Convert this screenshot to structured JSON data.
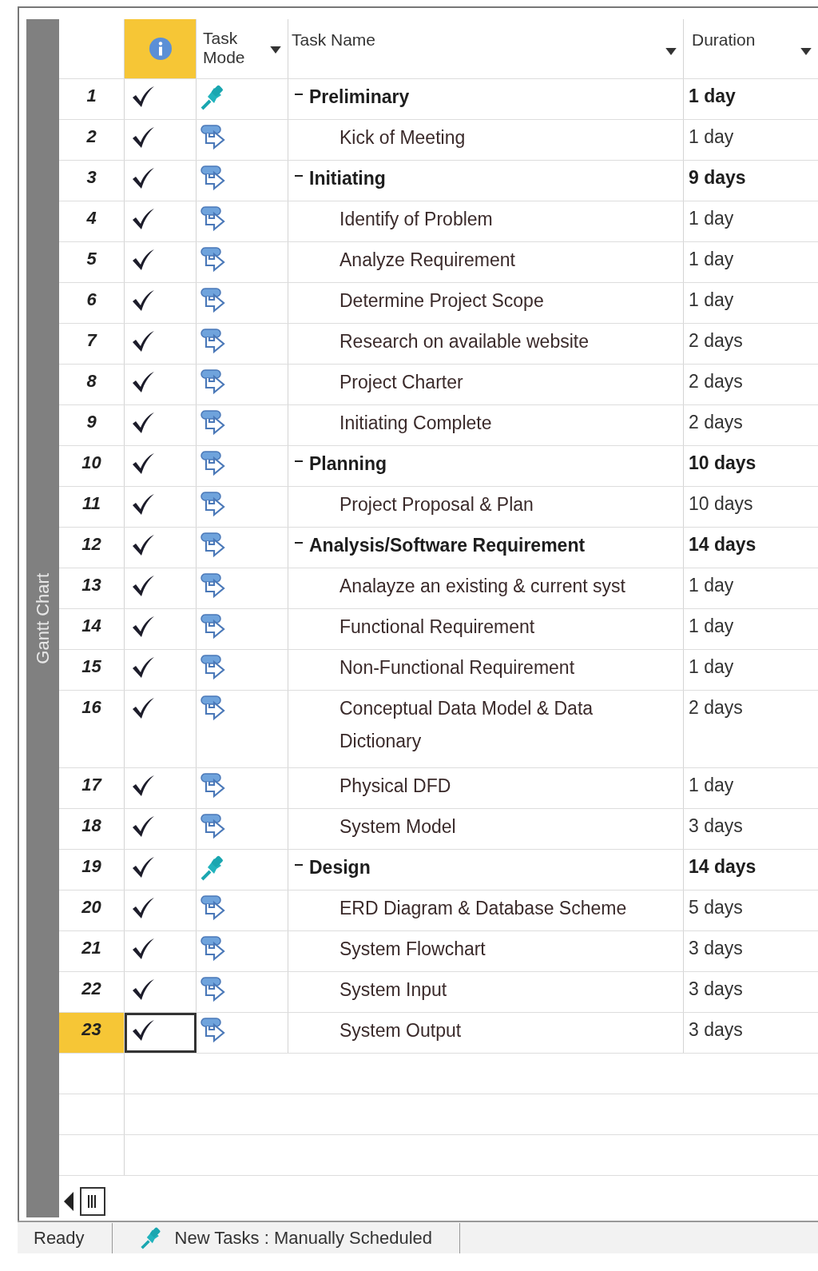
{
  "view_bar": {
    "label": "Gantt Chart"
  },
  "columns": [
    {
      "kind": "indicators"
    },
    {
      "kind": "mode",
      "label": "Task Mode"
    },
    {
      "kind": "name",
      "label": "Task Name"
    },
    {
      "kind": "duration",
      "label": "Duration"
    }
  ],
  "tasks": [
    {
      "id": "1",
      "name": "Preliminary",
      "duration": "1 day",
      "kind": "manual",
      "complete": true,
      "selected": false,
      "expanded": true,
      "children": [
        {
          "id": "2",
          "name": "Kick of Meeting",
          "duration": "1 day",
          "kind": "auto",
          "complete": true,
          "selected": false
        }
      ]
    },
    {
      "id": "3",
      "name": "Initiating",
      "duration": "9 days",
      "kind": "auto",
      "complete": true,
      "selected": false,
      "expanded": true,
      "children": [
        {
          "id": "4",
          "name": "Identify of Problem",
          "duration": "1 day",
          "kind": "auto",
          "complete": true,
          "selected": false
        },
        {
          "id": "5",
          "name": "Analyze Requirement",
          "duration": "1 day",
          "kind": "auto",
          "complete": true,
          "selected": false
        },
        {
          "id": "6",
          "name": "Determine Project Scope",
          "duration": "1 day",
          "kind": "auto",
          "complete": true,
          "selected": false
        },
        {
          "id": "7",
          "name": "Research on available website",
          "duration": "2 days",
          "kind": "auto",
          "complete": true,
          "selected": false
        },
        {
          "id": "8",
          "name": "Project Charter",
          "duration": "2 days",
          "kind": "auto",
          "complete": true,
          "selected": false
        },
        {
          "id": "9",
          "name": "Initiating Complete",
          "duration": "2 days",
          "kind": "auto",
          "complete": true,
          "selected": false
        }
      ]
    },
    {
      "id": "10",
      "name": "Planning",
      "duration": "10 days",
      "kind": "auto",
      "complete": true,
      "selected": false,
      "expanded": true,
      "children": [
        {
          "id": "11",
          "name": "Project Proposal & Plan",
          "duration": "10 days",
          "kind": "auto",
          "complete": true,
          "selected": false
        }
      ]
    },
    {
      "id": "12",
      "name": "Analysis/Software Requirement",
      "duration": "14 days",
      "kind": "auto",
      "complete": true,
      "selected": false,
      "expanded": true,
      "children": [
        {
          "id": "13",
          "name": "Analayze an existing & current syst",
          "duration": "1 day",
          "kind": "auto",
          "complete": true,
          "selected": false
        },
        {
          "id": "14",
          "name": "Functional Requirement",
          "duration": "1 day",
          "kind": "auto",
          "complete": true,
          "selected": false
        },
        {
          "id": "15",
          "name": "Non-Functional Requirement",
          "duration": "1 day",
          "kind": "auto",
          "complete": true,
          "selected": false
        },
        {
          "id": "16",
          "name": "Conceptual Data Model & Data Dictionary",
          "duration": "2 days",
          "kind": "auto",
          "complete": true,
          "selected": false
        },
        {
          "id": "17",
          "name": "Physical DFD",
          "duration": "1 day",
          "kind": "auto",
          "complete": true,
          "selected": false
        },
        {
          "id": "18",
          "name": "System Model",
          "duration": "3 days",
          "kind": "auto",
          "complete": true,
          "selected": false
        }
      ]
    },
    {
      "id": "19",
      "name": "Design",
      "duration": "14 days",
      "kind": "manual",
      "complete": true,
      "selected": false,
      "expanded": true,
      "children": [
        {
          "id": "20",
          "name": "ERD Diagram & Database Scheme",
          "duration": "5 days",
          "kind": "auto",
          "complete": true,
          "selected": false
        },
        {
          "id": "21",
          "name": "System Flowchart",
          "duration": "3 days",
          "kind": "auto",
          "complete": true,
          "selected": false
        },
        {
          "id": "22",
          "name": "System Input",
          "duration": "3 days",
          "kind": "auto",
          "complete": true,
          "selected": false
        },
        {
          "id": "23",
          "name": "System Output",
          "duration": "3 days",
          "kind": "auto",
          "complete": true,
          "selected": true
        }
      ]
    }
  ],
  "status_bar": {
    "state": "Ready",
    "new_tasks": "New Tasks : Manually Scheduled"
  }
}
